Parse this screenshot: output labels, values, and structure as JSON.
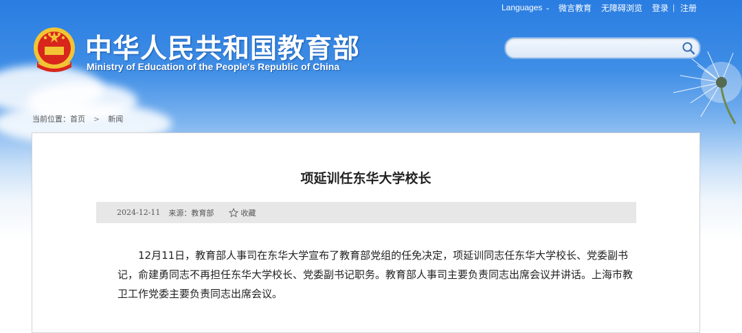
{
  "topnav": {
    "languages": "Languages",
    "weibo": "微言教育",
    "accessible": "无障碍浏览",
    "login": "登录",
    "separator": "|",
    "register": "注册"
  },
  "header": {
    "title_cn": "中华人民共和国教育部",
    "title_en": "Ministry of Education of the People's Republic of China"
  },
  "search": {
    "value": "",
    "placeholder": ""
  },
  "breadcrumb": {
    "prefix": "当前位置：",
    "home": "首页",
    "arrow": ">",
    "current": "新闻"
  },
  "article": {
    "title": "项延训任东华大学校长",
    "date": "2024-12-11",
    "source": "来源：教育部",
    "favorite": "收藏",
    "body": "12月11日，教育部人事司在东华大学宣布了教育部党组的任免决定，项延训同志任东华大学校长、党委副书记，俞建勇同志不再担任东华大学校长、党委副书记职务。教育部人事司主要负责同志出席会议并讲话。上海市教卫工作党委主要负责同志出席会议。"
  },
  "colors": {
    "sky_top": "#2a7de1",
    "emblem_red": "#d8261c",
    "emblem_gold": "#f2c434",
    "meta_bg": "#e7e7e7"
  },
  "icons": {
    "search": "search-icon",
    "favorite": "star-icon",
    "languages_chevron": "chevron-down-icon",
    "emblem": "national-emblem-icon"
  }
}
